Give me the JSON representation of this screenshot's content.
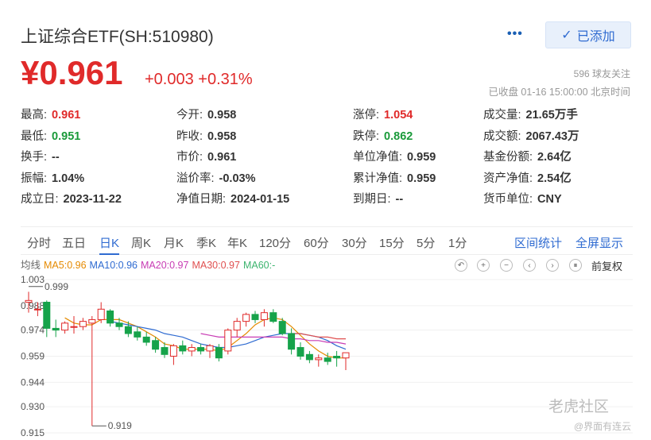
{
  "header": {
    "title": "上证综合ETF(SH:510980)",
    "more_label": "•••",
    "added_label": "已添加",
    "price": "¥0.961",
    "change": "+0.003 +0.31%",
    "followers": "596 球友关注",
    "status": "已收盘 01-16 15:00:00 北京时间"
  },
  "stats": [
    [
      {
        "label": "最高:",
        "value": "0.961",
        "color": "red"
      },
      {
        "label": "今开:",
        "value": "0.958",
        "color": ""
      },
      {
        "label": "涨停:",
        "value": "1.054",
        "color": "red"
      },
      {
        "label": "成交量:",
        "value": "21.65万手",
        "color": ""
      }
    ],
    [
      {
        "label": "最低:",
        "value": "0.951",
        "color": "green"
      },
      {
        "label": "昨收:",
        "value": "0.958",
        "color": ""
      },
      {
        "label": "跌停:",
        "value": "0.862",
        "color": "green"
      },
      {
        "label": "成交额:",
        "value": "2067.43万",
        "color": ""
      }
    ],
    [
      {
        "label": "换手:",
        "value": "--",
        "color": ""
      },
      {
        "label": "市价:",
        "value": "0.961",
        "color": ""
      },
      {
        "label": "单位净值:",
        "value": "0.959",
        "color": ""
      },
      {
        "label": "基金份额:",
        "value": "2.64亿",
        "color": ""
      }
    ],
    [
      {
        "label": "振幅:",
        "value": "1.04%",
        "color": ""
      },
      {
        "label": "溢价率:",
        "value": "-0.03%",
        "color": ""
      },
      {
        "label": "累计净值:",
        "value": "0.959",
        "color": ""
      },
      {
        "label": "资产净值:",
        "value": "2.54亿",
        "color": ""
      }
    ],
    [
      {
        "label": "成立日:",
        "value": "2023-11-22",
        "color": ""
      },
      {
        "label": "净值日期:",
        "value": "2024-01-15",
        "color": ""
      },
      {
        "label": "到期日:",
        "value": "--",
        "color": ""
      },
      {
        "label": "货币单位:",
        "value": "CNY",
        "color": ""
      }
    ]
  ],
  "tabs": [
    "分时",
    "五日",
    "日K",
    "周K",
    "月K",
    "季K",
    "年K",
    "120分",
    "60分",
    "30分",
    "15分",
    "5分",
    "1分"
  ],
  "active_tab": "日K",
  "tab_actions": [
    "区间统计",
    "全屏显示"
  ],
  "ma_legend": [
    {
      "text": "均线",
      "color": "#666666"
    },
    {
      "text": "MA5:0.96",
      "color": "#e58a00"
    },
    {
      "text": "MA10:0.96",
      "color": "#2f6bd1"
    },
    {
      "text": "MA20:0.97",
      "color": "#c83cb4"
    },
    {
      "text": "MA30:0.97",
      "color": "#e05050"
    },
    {
      "text": "MA60:-",
      "color": "#3cb46e"
    }
  ],
  "controls": [
    "↶",
    "+",
    "−",
    "‹",
    "›",
    "⏸"
  ],
  "fuquan_label": "前复权",
  "colors": {
    "up": "#e02a2a",
    "down": "#16a34a",
    "accent": "#2f6bd1"
  },
  "chart_data": {
    "type": "candlestick",
    "y_ticks": [
      "1.003",
      "0.988",
      "0.974",
      "0.959",
      "0.944",
      "0.930",
      "0.915"
    ],
    "ylim": [
      0.915,
      1.003
    ],
    "annotations": [
      {
        "text": "0.999",
        "kind": "max"
      },
      {
        "text": "0.919",
        "kind": "min"
      }
    ],
    "candles": [
      {
        "o": 0.99,
        "h": 0.996,
        "l": 0.984,
        "c": 0.991
      },
      {
        "o": 0.986,
        "h": 0.99,
        "l": 0.982,
        "c": 0.986
      },
      {
        "o": 0.99,
        "h": 0.991,
        "l": 0.97,
        "c": 0.975
      },
      {
        "o": 0.975,
        "h": 0.98,
        "l": 0.97,
        "c": 0.974
      },
      {
        "o": 0.974,
        "h": 0.979,
        "l": 0.972,
        "c": 0.978
      },
      {
        "o": 0.976,
        "h": 0.982,
        "l": 0.972,
        "c": 0.976
      },
      {
        "o": 0.976,
        "h": 0.981,
        "l": 0.974,
        "c": 0.979
      },
      {
        "o": 0.978,
        "h": 0.982,
        "l": 0.919,
        "c": 0.98
      },
      {
        "o": 0.98,
        "h": 0.99,
        "l": 0.978,
        "c": 0.986
      },
      {
        "o": 0.985,
        "h": 0.986,
        "l": 0.976,
        "c": 0.978
      },
      {
        "o": 0.978,
        "h": 0.981,
        "l": 0.974,
        "c": 0.976
      },
      {
        "o": 0.976,
        "h": 0.979,
        "l": 0.97,
        "c": 0.972
      },
      {
        "o": 0.973,
        "h": 0.976,
        "l": 0.968,
        "c": 0.97
      },
      {
        "o": 0.97,
        "h": 0.973,
        "l": 0.965,
        "c": 0.967
      },
      {
        "o": 0.968,
        "h": 0.97,
        "l": 0.961,
        "c": 0.963
      },
      {
        "o": 0.964,
        "h": 0.967,
        "l": 0.958,
        "c": 0.96
      },
      {
        "o": 0.959,
        "h": 0.966,
        "l": 0.954,
        "c": 0.965
      },
      {
        "o": 0.965,
        "h": 0.968,
        "l": 0.96,
        "c": 0.962
      },
      {
        "o": 0.962,
        "h": 0.966,
        "l": 0.959,
        "c": 0.964
      },
      {
        "o": 0.964,
        "h": 0.966,
        "l": 0.96,
        "c": 0.962
      },
      {
        "o": 0.962,
        "h": 0.966,
        "l": 0.958,
        "c": 0.965
      },
      {
        "o": 0.964,
        "h": 0.966,
        "l": 0.956,
        "c": 0.958
      },
      {
        "o": 0.962,
        "h": 0.975,
        "l": 0.96,
        "c": 0.974
      },
      {
        "o": 0.974,
        "h": 0.981,
        "l": 0.97,
        "c": 0.979
      },
      {
        "o": 0.979,
        "h": 0.984,
        "l": 0.976,
        "c": 0.983
      },
      {
        "o": 0.983,
        "h": 0.985,
        "l": 0.978,
        "c": 0.98
      },
      {
        "o": 0.98,
        "h": 0.986,
        "l": 0.976,
        "c": 0.984
      },
      {
        "o": 0.984,
        "h": 0.986,
        "l": 0.978,
        "c": 0.979
      },
      {
        "o": 0.979,
        "h": 0.981,
        "l": 0.971,
        "c": 0.972
      },
      {
        "o": 0.972,
        "h": 0.975,
        "l": 0.96,
        "c": 0.963
      },
      {
        "o": 0.964,
        "h": 0.967,
        "l": 0.957,
        "c": 0.959
      },
      {
        "o": 0.96,
        "h": 0.962,
        "l": 0.955,
        "c": 0.957
      },
      {
        "o": 0.957,
        "h": 0.96,
        "l": 0.953,
        "c": 0.958
      },
      {
        "o": 0.958,
        "h": 0.961,
        "l": 0.954,
        "c": 0.956
      },
      {
        "o": 0.959,
        "h": 0.962,
        "l": 0.953,
        "c": 0.958
      },
      {
        "o": 0.958,
        "h": 0.961,
        "l": 0.951,
        "c": 0.961
      }
    ],
    "ma5": [
      null,
      null,
      null,
      null,
      0.981,
      0.978,
      0.977,
      0.977,
      0.98,
      0.98,
      0.98,
      0.978,
      0.976,
      0.973,
      0.97,
      0.966,
      0.965,
      0.963,
      0.963,
      0.963,
      0.963,
      0.962,
      0.964,
      0.968,
      0.972,
      0.977,
      0.98,
      0.981,
      0.98,
      0.976,
      0.971,
      0.966,
      0.962,
      0.959,
      0.958,
      0.958
    ],
    "ma10": [
      null,
      null,
      null,
      null,
      null,
      null,
      null,
      null,
      null,
      0.979,
      0.978,
      0.977,
      0.976,
      0.975,
      0.974,
      0.972,
      0.971,
      0.97,
      0.968,
      0.966,
      0.965,
      0.964,
      0.964,
      0.965,
      0.966,
      0.968,
      0.97,
      0.971,
      0.972,
      0.972,
      0.972,
      0.971,
      0.97,
      0.968,
      0.965,
      0.963
    ],
    "ma20": [
      null,
      null,
      null,
      null,
      null,
      null,
      null,
      null,
      null,
      null,
      null,
      null,
      null,
      null,
      null,
      null,
      null,
      null,
      null,
      0.972,
      0.971,
      0.97,
      0.97,
      0.97,
      0.97,
      0.97,
      0.97,
      0.97,
      0.97,
      0.969,
      0.969,
      0.968,
      0.968,
      0.967,
      0.967,
      0.966
    ],
    "ma30": [
      null,
      null,
      null,
      null,
      null,
      null,
      null,
      null,
      null,
      null,
      null,
      null,
      null,
      null,
      null,
      null,
      null,
      null,
      null,
      null,
      null,
      null,
      null,
      null,
      null,
      null,
      null,
      null,
      null,
      0.972,
      0.972,
      0.971,
      0.97,
      0.97,
      0.969,
      0.969
    ]
  },
  "watermark": {
    "brand": "老虎社区",
    "credit": "@界面有连云"
  }
}
